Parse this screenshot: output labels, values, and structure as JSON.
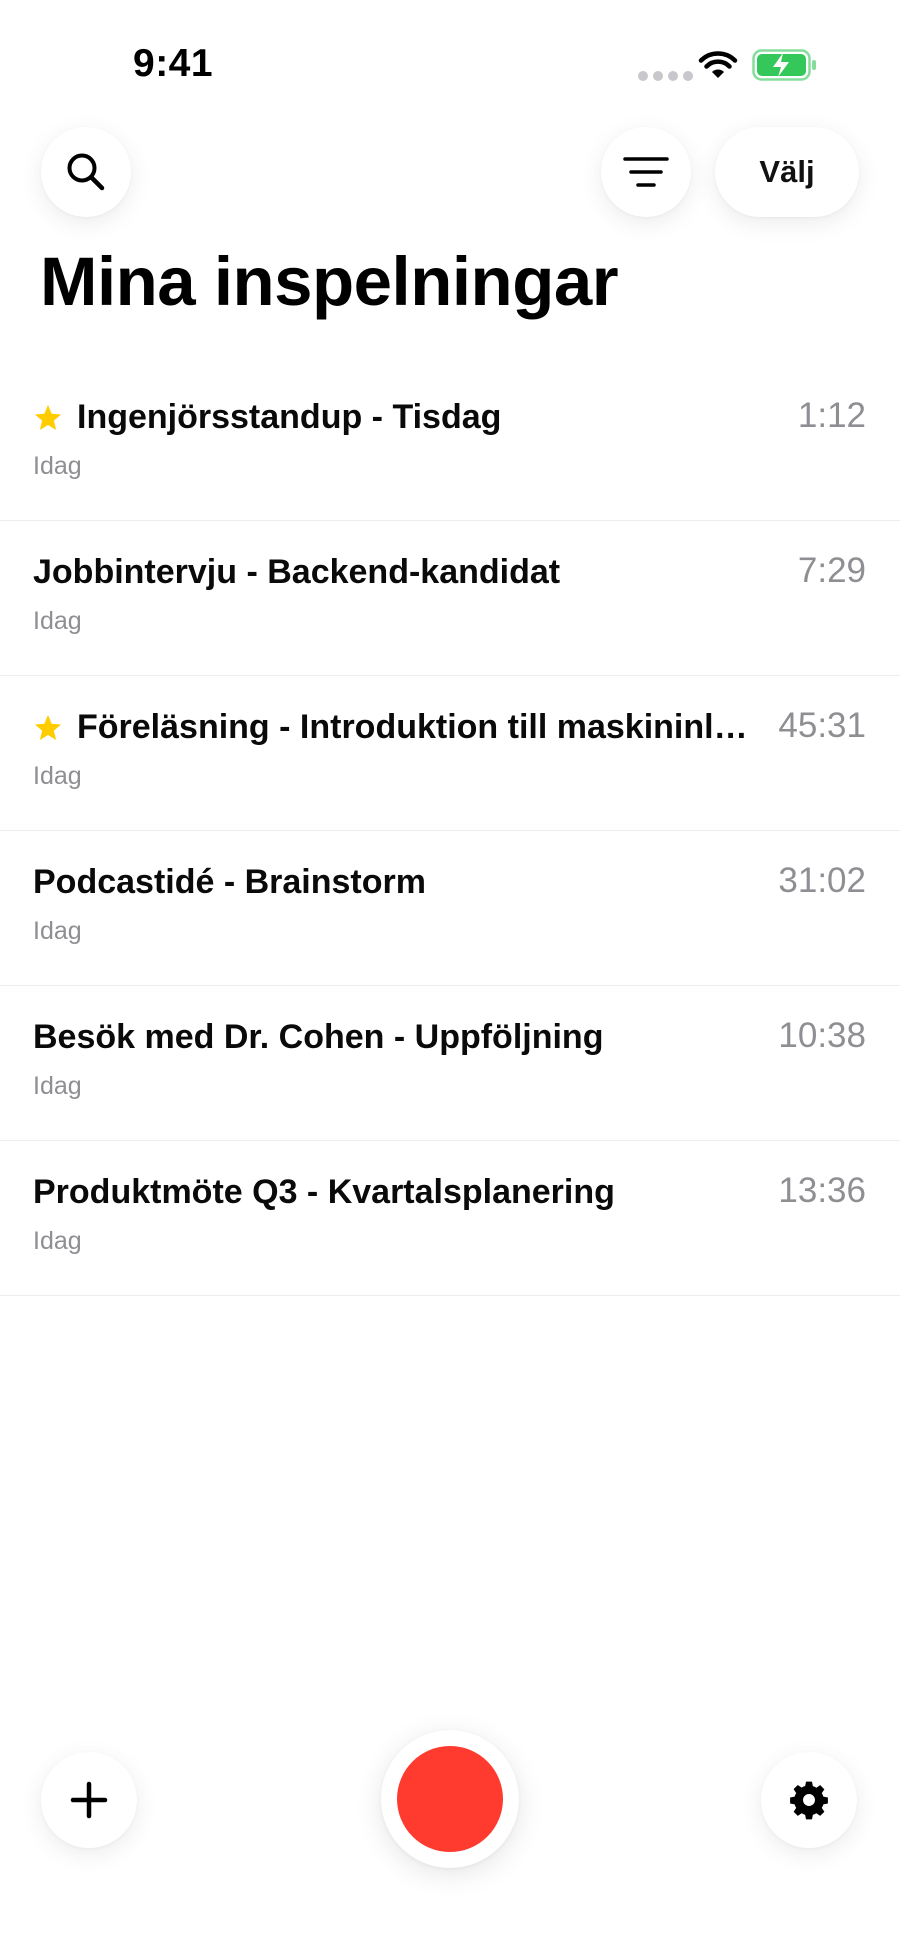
{
  "status_bar": {
    "time": "9:41",
    "icons": [
      "signal-icon",
      "wifi-icon",
      "battery-charging-icon"
    ],
    "battery_color": "#34c759"
  },
  "header": {
    "search_icon": "search-icon",
    "filter_icon": "filter-icon",
    "select_label": "Välj",
    "title": "Mina inspelningar"
  },
  "recordings": [
    {
      "title": "Ingenjörsstandup - Tisdag",
      "date": "Idag",
      "duration": "1:12",
      "starred": true
    },
    {
      "title": "Jobbintervju - Backend-kandidat",
      "date": "Idag",
      "duration": "7:29",
      "starred": false
    },
    {
      "title": "Föreläsning - Introduktion till maskininlärn...",
      "date": "Idag",
      "duration": "45:31",
      "starred": true
    },
    {
      "title": "Podcastidé - Brainstorm",
      "date": "Idag",
      "duration": "31:02",
      "starred": false
    },
    {
      "title": "Besök med Dr. Cohen - Uppföljning",
      "date": "Idag",
      "duration": "10:38",
      "starred": false
    },
    {
      "title": "Produktmöte Q3 - Kvartalsplanering",
      "date": "Idag",
      "duration": "13:36",
      "starred": false
    }
  ],
  "bottom_bar": {
    "add_icon": "plus-icon",
    "record_icon": "record-icon",
    "settings_icon": "gear-icon",
    "record_color": "#ff3b30"
  },
  "colors": {
    "star": "#ffcc00",
    "secondary_text": "#8e8e93"
  }
}
